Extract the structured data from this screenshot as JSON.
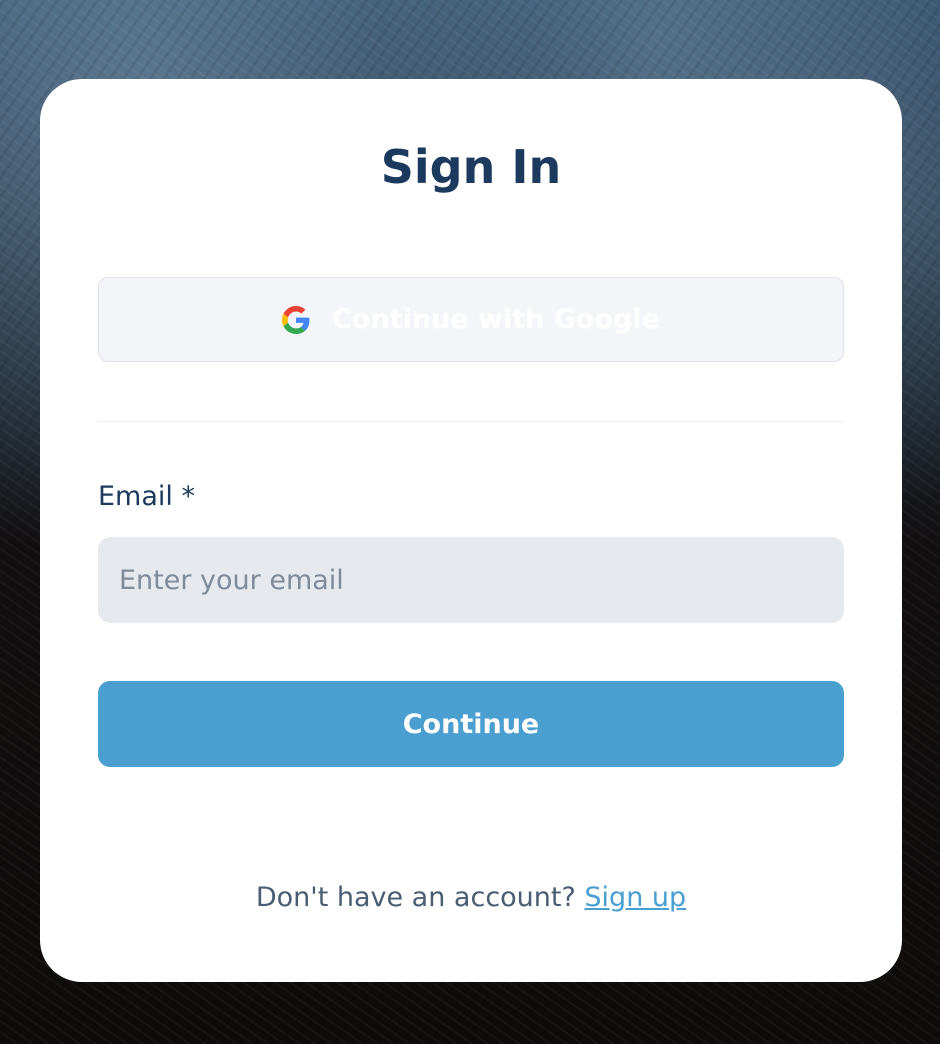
{
  "card": {
    "title": "Sign In"
  },
  "google": {
    "label": "Continue with Google",
    "icon": "google-icon"
  },
  "email": {
    "label": "Email *",
    "placeholder": "Enter your email",
    "value": ""
  },
  "actions": {
    "continue_label": "Continue"
  },
  "footer": {
    "prompt": "Don't have an account?",
    "signup_label": "Sign up"
  },
  "colors": {
    "heading": "#1c3a5e",
    "primary": "#4a9fd0",
    "input_bg": "#e6e9ed",
    "google_btn_bg": "#f3f5f8"
  }
}
